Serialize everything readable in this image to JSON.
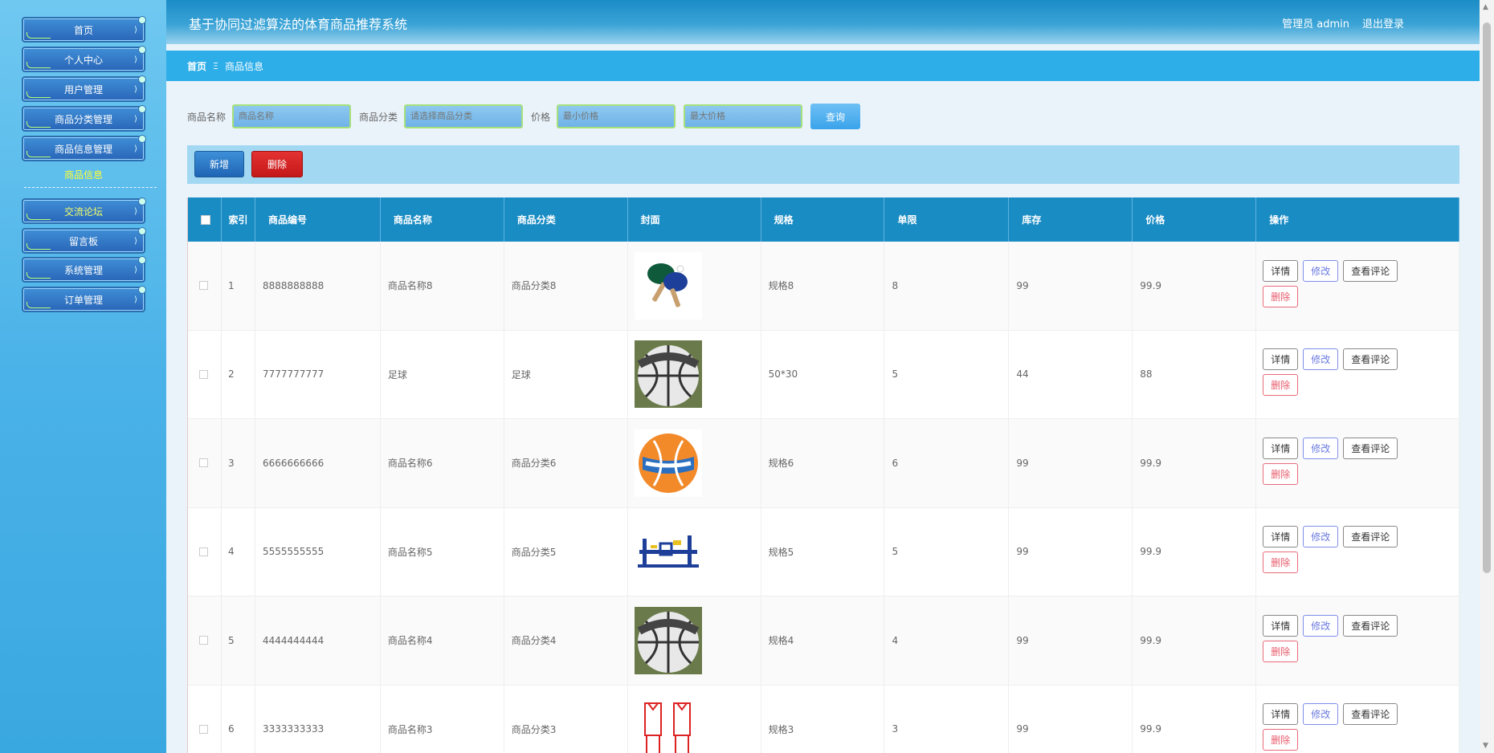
{
  "app_title": "基于协同过滤算法的体育商品推荐系统",
  "header": {
    "user_label": "管理员 admin",
    "logout_label": "退出登录"
  },
  "sidebar": {
    "items": [
      {
        "label": "首页"
      },
      {
        "label": "个人中心"
      },
      {
        "label": "用户管理"
      },
      {
        "label": "商品分类管理"
      },
      {
        "label": "商品信息管理"
      },
      {
        "label": "交流论坛"
      },
      {
        "label": "留言板"
      },
      {
        "label": "系统管理"
      },
      {
        "label": "订单管理"
      }
    ],
    "sub_item": "商品信息"
  },
  "breadcrumb": {
    "home": "首页",
    "separator": "Ξ",
    "current": "商品信息"
  },
  "search": {
    "name_label": "商品名称",
    "name_placeholder": "商品名称",
    "category_label": "商品分类",
    "category_placeholder": "请选择商品分类",
    "price_label": "价格",
    "price_min_placeholder": "最小价格",
    "price_max_placeholder": "最大价格",
    "query_button": "查询"
  },
  "actions": {
    "add": "新增",
    "delete": "删除"
  },
  "table": {
    "columns": [
      "索引",
      "商品编号",
      "商品名称",
      "商品分类",
      "封面",
      "规格",
      "单限",
      "库存",
      "价格",
      "操作"
    ],
    "rows": [
      {
        "index": "1",
        "code": "8888888888",
        "name": "商品名称8",
        "category": "商品分类8",
        "cover": "table-tennis-paddles",
        "spec": "规格8",
        "limit": "8",
        "stock": "99",
        "price": "99.9"
      },
      {
        "index": "2",
        "code": "7777777777",
        "name": "足球",
        "category": "足球",
        "cover": "basketball",
        "spec": "50*30",
        "limit": "5",
        "stock": "44",
        "price": "88"
      },
      {
        "index": "3",
        "code": "6666666666",
        "name": "商品名称6",
        "category": "商品分类6",
        "cover": "volleyball",
        "spec": "规格6",
        "limit": "6",
        "stock": "99",
        "price": "99.9"
      },
      {
        "index": "4",
        "code": "5555555555",
        "name": "商品名称5",
        "category": "商品分类5",
        "cover": "fitness-equipment",
        "spec": "规格5",
        "limit": "5",
        "stock": "99",
        "price": "99.9"
      },
      {
        "index": "5",
        "code": "4444444444",
        "name": "商品名称4",
        "category": "商品分类4",
        "cover": "basketball",
        "spec": "规格4",
        "limit": "4",
        "stock": "99",
        "price": "99.9"
      },
      {
        "index": "6",
        "code": "3333333333",
        "name": "商品名称3",
        "category": "商品分类3",
        "cover": "sports-uniform",
        "spec": "规格3",
        "limit": "3",
        "stock": "99",
        "price": "99.9"
      }
    ],
    "row_buttons": {
      "detail": "详情",
      "edit": "修改",
      "reviews": "查看评论",
      "delete": "删除"
    }
  },
  "colors": {
    "header": "#1b8cc6",
    "breadcrumb": "#2eaee8",
    "table_header": "#1a8cc4",
    "sidebar": "#4ab2e8",
    "delete_red": "#d42222"
  }
}
